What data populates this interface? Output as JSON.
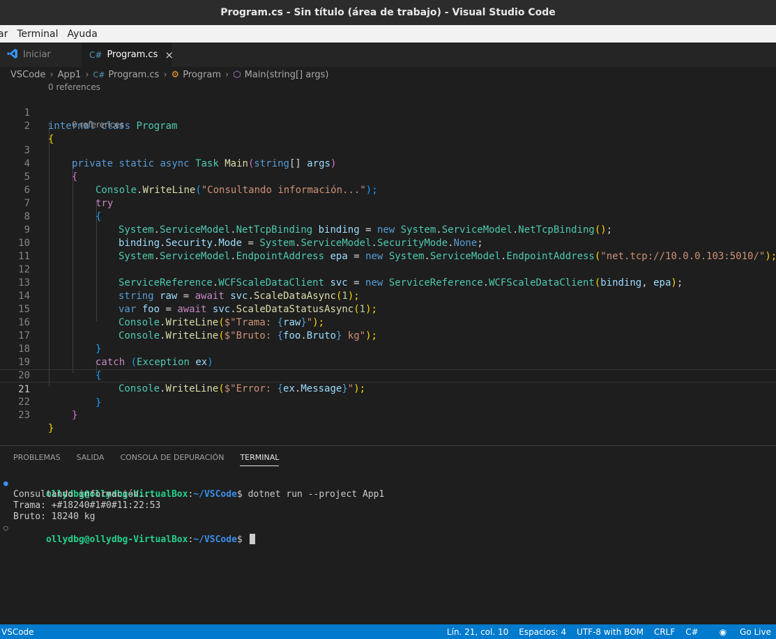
{
  "window": {
    "title": "Program.cs - Sin título (área de trabajo) - Visual Studio Code"
  },
  "menu": [
    "ar",
    "Terminal",
    "Ayuda"
  ],
  "tabs": [
    {
      "label": "Iniciar",
      "icon": "vscode-logo-icon"
    },
    {
      "label": "Program.cs",
      "icon": "csharp-file-icon",
      "close": "×"
    }
  ],
  "breadcrumb": [
    "VSCode",
    "App1",
    "Program.cs",
    "Program",
    "Main(string[] args)"
  ],
  "codelens": {
    "class_refs": "0 references",
    "method_refs": "0 references"
  },
  "line_numbers": [
    "1",
    "2",
    "3",
    "4",
    "5",
    "6",
    "7",
    "8",
    "9",
    "10",
    "11",
    "12",
    "13",
    "14",
    "15",
    "16",
    "17",
    "18",
    "19",
    "20",
    "21",
    "22",
    "23"
  ],
  "code": {
    "l1": [
      "internal",
      " ",
      "class",
      " ",
      "Program"
    ],
    "l2": [
      "{"
    ],
    "l3": [
      "private",
      " ",
      "static",
      " ",
      "async",
      " ",
      "Task",
      " ",
      "Main",
      "(",
      "string",
      "[] ",
      "args",
      ")"
    ],
    "l4": [
      "{"
    ],
    "l5": [
      "Console",
      ".",
      "WriteLine",
      "(",
      "\"Consultando información...\"",
      ");"
    ],
    "l6": [
      "try"
    ],
    "l7": [
      "{"
    ],
    "l8": [
      "System",
      ".",
      "ServiceModel",
      ".",
      "NetTcpBinding",
      " ",
      "binding",
      " = ",
      "new",
      " ",
      "System",
      ".",
      "ServiceModel",
      ".",
      "NetTcpBinding",
      "()",
      ";"
    ],
    "l9": [
      "binding",
      ".",
      "Security",
      ".",
      "Mode",
      " = ",
      "System",
      ".",
      "ServiceModel",
      ".",
      "SecurityMode",
      ".",
      "None",
      ";"
    ],
    "l10": [
      "System",
      ".",
      "ServiceModel",
      ".",
      "EndpointAddress",
      " ",
      "epa",
      " = ",
      "new",
      " ",
      "System",
      ".",
      "ServiceModel",
      ".",
      "EndpointAddress",
      "(",
      "\"net.tcp://10.0.0.103:5010/\"",
      ");"
    ],
    "l12": [
      "ServiceReference",
      ".",
      "WCFScaleDataClient",
      " ",
      "svc",
      " = ",
      "new",
      " ",
      "ServiceReference",
      ".",
      "WCFScaleDataClient",
      "(",
      "binding",
      ", ",
      "epa",
      ")",
      ";"
    ],
    "l13": [
      "string",
      " ",
      "raw",
      " = ",
      "await",
      " ",
      "svc",
      ".",
      "ScaleDataAsync",
      "(",
      "1",
      ");"
    ],
    "l14": [
      "var",
      " ",
      "foo",
      " = ",
      "await",
      " ",
      "svc",
      ".",
      "ScaleDataStatusAsync",
      "(",
      "1",
      ");"
    ],
    "l15": [
      "Console",
      ".",
      "WriteLine",
      "(",
      "$\"Trama: ",
      "{",
      "raw",
      "}",
      "\"",
      ");"
    ],
    "l16": [
      "Console",
      ".",
      "WriteLine",
      "(",
      "$\"Bruto: ",
      "{",
      "foo",
      ".",
      "Bruto",
      "}",
      " kg\"",
      ");"
    ],
    "l17": [
      "}"
    ],
    "l18": [
      "catch",
      " ",
      "(",
      "Exception",
      " ",
      "ex",
      ")"
    ],
    "l19": [
      "{"
    ],
    "l20": [
      "Console",
      ".",
      "WriteLine",
      "(",
      "$\"Error: ",
      "{",
      "ex",
      ".",
      "Message",
      "}",
      "\"",
      ");"
    ],
    "l21": [
      "}"
    ],
    "l22": [
      "}"
    ],
    "l23": [
      "}"
    ]
  },
  "panel": {
    "tabs": [
      "PROBLEMAS",
      "SALIDA",
      "CONSOLA DE DEPURACIÓN",
      "TERMINAL"
    ],
    "active_tab": "TERMINAL"
  },
  "terminal": {
    "user": "ollydbg@ollydbg-VirtualBox",
    "sep": ":",
    "path": "~/VSCode",
    "prompt": "$ ",
    "command": "dotnet run --project App1",
    "output": [
      "Consultando información...",
      "Trama: +#18240#1#0#11:22:53",
      "Bruto: 18240 kg"
    ],
    "colors": {
      "user": "#23d18b",
      "path": "#3b8eea"
    }
  },
  "statusbar": {
    "left": "VSCode",
    "position": "Lín. 21, col. 10",
    "spaces": "Espacios: 4",
    "encoding": "UTF-8 with BOM",
    "eol": "CRLF",
    "language": "C#",
    "golive": "Go Live"
  },
  "colors": {
    "status_bg": "#007acc",
    "editor_bg": "#1e1e1e",
    "titlebar_bg": "#2c2c2c"
  }
}
